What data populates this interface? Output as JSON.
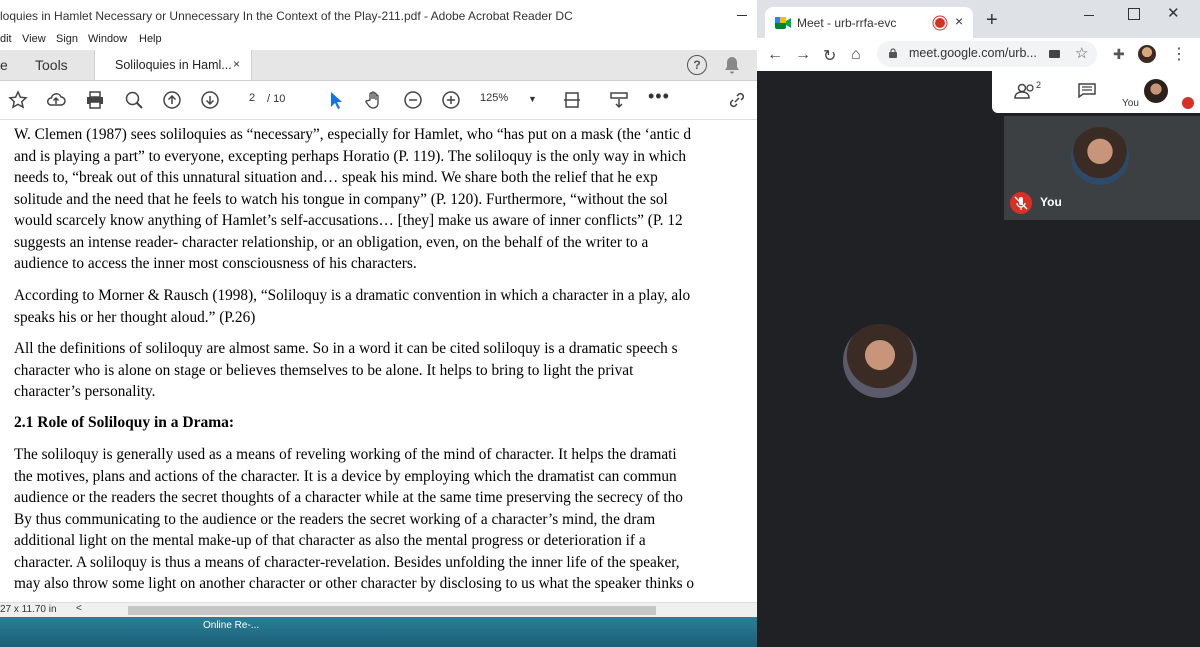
{
  "acrobat": {
    "title": "loquies in Hamlet Necessary or Unnecessary In the Context of the Play-211.pdf - Adobe Acrobat Reader DC",
    "menu": [
      "dit",
      "View",
      "Sign",
      "Window",
      "Help"
    ],
    "tabs": {
      "home": "e",
      "tools": "Tools",
      "document": "Soliloquies in Haml...",
      "document_close": "×"
    },
    "toolbar": {
      "page_current": "2",
      "page_total": "/ 10",
      "zoom": "125%",
      "more": "•••"
    },
    "document": {
      "paragraphs": [
        [
          "W. Clemen (1987) sees soliloquies as “necessary”, especially for Hamlet, who “has put on a mask (the ‘antic d",
          "and is playing a part” to everyone, excepting perhaps Horatio (P. 119). The soliloquy is the only way in which",
          "needs to, “break out of this unnatural situation and… speak his mind. We share both the relief that he exp",
          "solitude and the need that he feels to watch his tongue in company” (P. 120). Furthermore, “without the sol",
          "would scarcely know anything of Hamlet’s self-accusations… [they] make us aware of inner conflicts” (P. 12",
          "suggests an intense reader- character relationship, or an obligation, even, on the behalf of the writer to a",
          "audience to access the inner most consciousness of his characters."
        ],
        [
          "According to Morner & Rausch (1998), “Soliloquy is a dramatic convention in which a character in a play, alo",
          "speaks his or her thought aloud.” (P.26)"
        ],
        [
          "All the definitions of soliloquy are almost same. So in a word it can be cited soliloquy is a dramatic speech s",
          "character who is alone on stage or believes themselves to be alone. It helps to bring to light the privat",
          "character’s personality."
        ],
        [
          "The soliloquy is generally used as a means of reveling working of the mind of character. It helps the dramati",
          "the motives, plans and actions of the character. It is a device by employing which the dramatist can commun",
          "audience or the readers the secret thoughts of a character while at the same time preserving the secrecy of tho",
          "By thus communicating to the audience or the readers the secret working of a character’s mind, the dram",
          "additional light on the mental make-up of that character as also the mental progress or deterioration if a",
          "character. A soliloquy is thus a means of character-revelation. Besides unfolding the inner life of the speaker,",
          "may also throw some light on another character or other character by disclosing to us what the speaker thinks o"
        ]
      ],
      "heading": "2.1 Role of Soliloquy in a Drama:"
    },
    "status": {
      "page_size": "27 x 11.70 in",
      "scroll_left": "<"
    }
  },
  "chrome": {
    "tab_title": "Meet - urb-rrfa-evc",
    "tab_close": "×",
    "new_tab": "+",
    "window_close": "✕",
    "url": "meet.google.com/urb...",
    "nav": {
      "back": "←",
      "forward": "→",
      "reload": "↻",
      "home": "⌂"
    },
    "menu": "⋮"
  },
  "meet": {
    "participant_count": "2",
    "self_label_small": "You",
    "self_name": "You"
  },
  "desktop": {
    "taskbar_item": "Online Re-..."
  },
  "colors": {
    "record_red": "#d93025",
    "meet_bg": "#202124",
    "tile_bg": "#3c4043"
  }
}
